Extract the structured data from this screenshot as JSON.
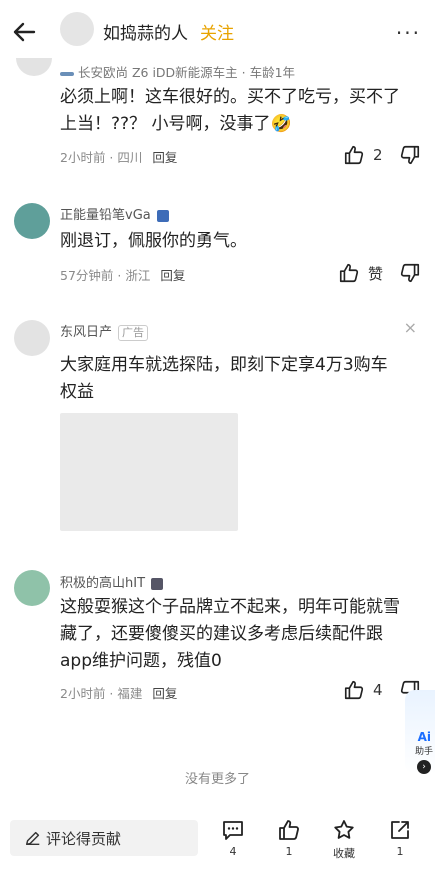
{
  "header": {
    "author_name": "如捣蒜的人",
    "follow_label": "关注",
    "more_label": "···"
  },
  "comments": [
    {
      "user_badge": "长安欧尚 Z6 iDD新能源车主 · 车龄1年",
      "text_line1": "必须上啊！这车很好的。买不了吃亏，买不了",
      "text_line2": "上当！??？ 小号啊，没事了🤣",
      "time_location": "2小时前 · 四川",
      "reply_label": "回复",
      "like_count": "2"
    },
    {
      "username": "正能量铅笔vGa",
      "text": "刚退订，佩服你的勇气。",
      "time_location": "57分钟前 · 浙江",
      "reply_label": "回复",
      "like_label": "赞"
    },
    {
      "username": "积极的高山hIT",
      "text_line1": "这般耍猴这个子品牌立不起来，明年可能就雪",
      "text_line2": "藏了，还要傻傻买的建议多考虑后续配件跟",
      "text_line3": "app维护问题，残值0",
      "time_location": "2小时前 · 福建",
      "reply_label": "回复",
      "like_count": "4"
    }
  ],
  "ad": {
    "advertiser": "东风日产",
    "tag": "广告",
    "close_icon": "×",
    "text_line1": "大家庭用车就选探陆，即刻下定享4万3购车",
    "text_line2": "权益"
  },
  "footer_text": "没有更多了",
  "ai_assistant": {
    "label": "Ai",
    "sub_label": "助手",
    "arrow": "›"
  },
  "bottom_bar": {
    "comment_placeholder": "评论得贡献",
    "comment_count": "4",
    "like_count": "1",
    "favorite_label": "收藏",
    "share_count": "1"
  },
  "colors": {
    "accent": "#e8a300",
    "text": "#222222",
    "muted": "#8a8a8a"
  },
  "icons": [
    "back-arrow-icon",
    "more-icon",
    "thumb-up-icon",
    "thumb-down-icon",
    "comment-icon",
    "star-icon",
    "share-icon",
    "pencil-icon",
    "close-icon"
  ]
}
